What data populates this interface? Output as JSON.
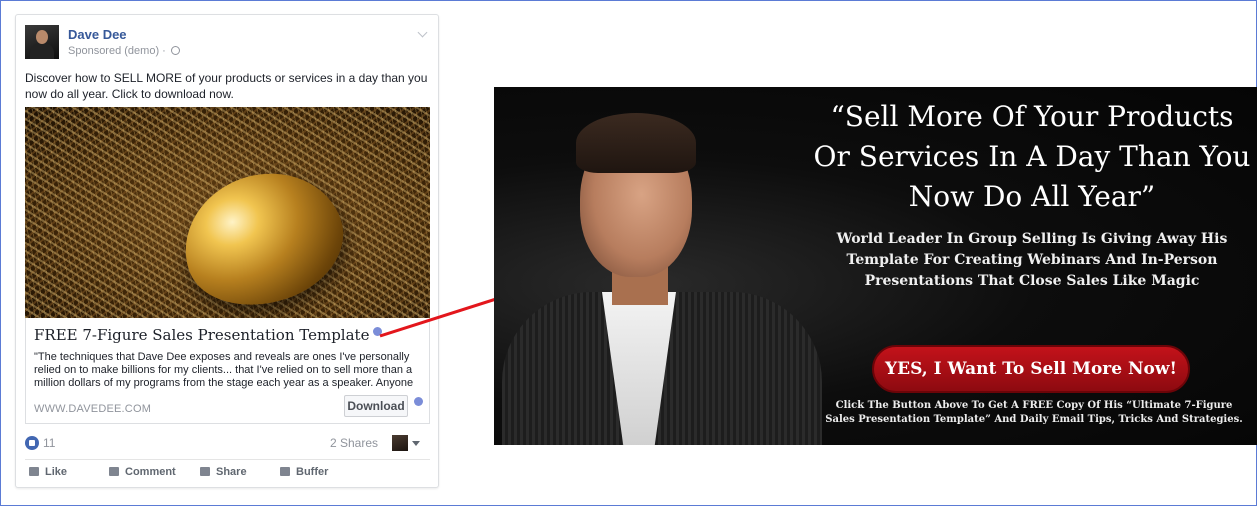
{
  "post": {
    "author": "Dave Dee",
    "sponsored": "Sponsored (demo) ·",
    "text": "Discover how to SELL MORE of your products or services in a day than you now do all year. Click to download now.",
    "link": {
      "title": "FREE 7-Figure Sales Presentation Template",
      "description": "\"The techniques that Dave Dee exposes and reveals are ones I've personally relied on to make billions for my clients... that I've relied on to sell more than a million dollars of my programs from the stage each year as a speaker. Anyone should pay…",
      "domain": "WWW.DAVEDEE.COM",
      "button_label": "Download"
    },
    "stats": {
      "likes": "11",
      "shares": "2 Shares"
    },
    "actions": [
      "Like",
      "Comment",
      "Share",
      "Buffer"
    ]
  },
  "landing": {
    "headline": "“Sell More Of Your Products Or Services In A Day Than You Now Do All Year”",
    "subhead": "World Leader In Group Selling Is Giving Away His Template For Creating Webinars And In-Person Presentations That Close Sales Like Magic",
    "cta_label": "YES, I Want To Sell More Now!",
    "footnote": "Click The Button Above To Get A FREE Copy Of His “Ultimate 7-Figure Sales Presentation Template” And Daily Email Tips, Tricks And Strategies."
  },
  "colors": {
    "facebook_link": "#365899",
    "cta_red": "#c3121a",
    "arrow_red": "#e3161c"
  }
}
